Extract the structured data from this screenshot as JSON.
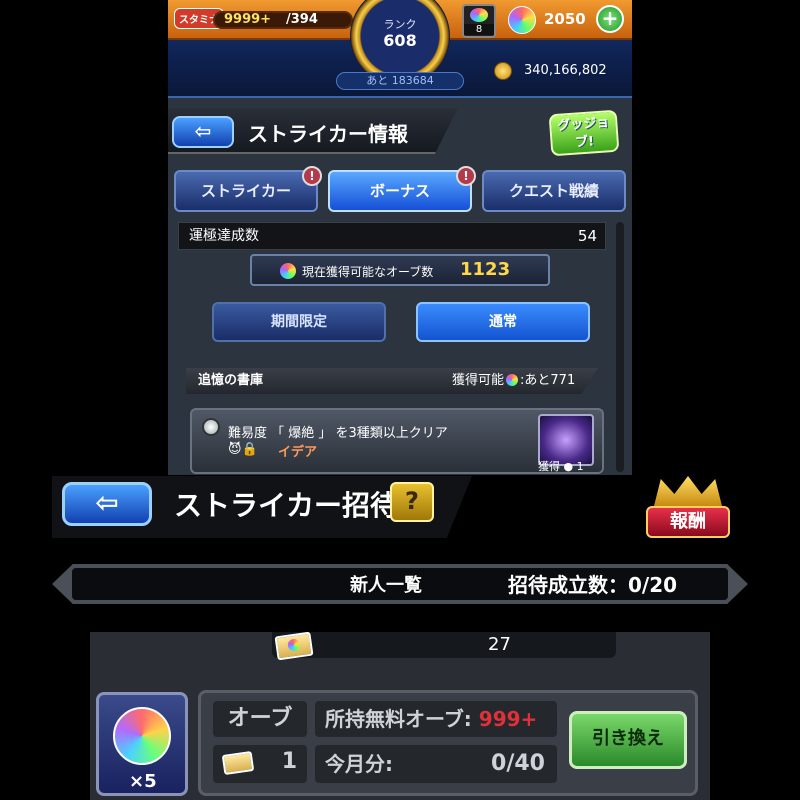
{
  "hud": {
    "stamina_label": "スタミナ",
    "stamina_value": "9999+",
    "stamina_max": "/394",
    "rank_label": "ランク",
    "rank_value": "608",
    "rank_next": "あと 183684",
    "orb_box_value": "8",
    "orb_count": "2050",
    "gold": "340,166,802"
  },
  "header": {
    "back_symbol": "⇦",
    "title": "ストライカー情報",
    "gujob_label": "グッジョブ!"
  },
  "tabs": [
    {
      "label": "ストライカー",
      "alert": "!"
    },
    {
      "label": "ボーナス",
      "alert": "!"
    },
    {
      "label": "クエスト戦績"
    }
  ],
  "achievement": {
    "label": "運極達成数",
    "value": "54"
  },
  "orb_available": {
    "label": "現在獲得可能なオーブ数",
    "value": "1123"
  },
  "sub_tabs": {
    "limited": "期間限定",
    "normal": "通常"
  },
  "section": {
    "title": "追憶の書庫",
    "available_prefix": "獲得可能",
    "available_suffix": ":あと771"
  },
  "quest": {
    "text": "難易度 「 爆絶 」 を3種類以上クリア",
    "sub": "イデア",
    "reward_label": "獲得",
    "reward_value": "1"
  },
  "invite": {
    "back_symbol": "⇦",
    "title": "ストライカー招待",
    "help_symbol": "?",
    "reward_label": "報酬",
    "list_label": "新人一覧",
    "count_label": "招待成立数：0/20"
  },
  "bottom": {
    "ticket_count": "27",
    "orb_mult": "×5",
    "orb_label": "オーブ",
    "free_label": "所持無料オーブ:",
    "free_value": "999+",
    "ticket_value": "1",
    "month_label": "今月分:",
    "month_value": "0/40",
    "exchange_label": "引き換え"
  }
}
